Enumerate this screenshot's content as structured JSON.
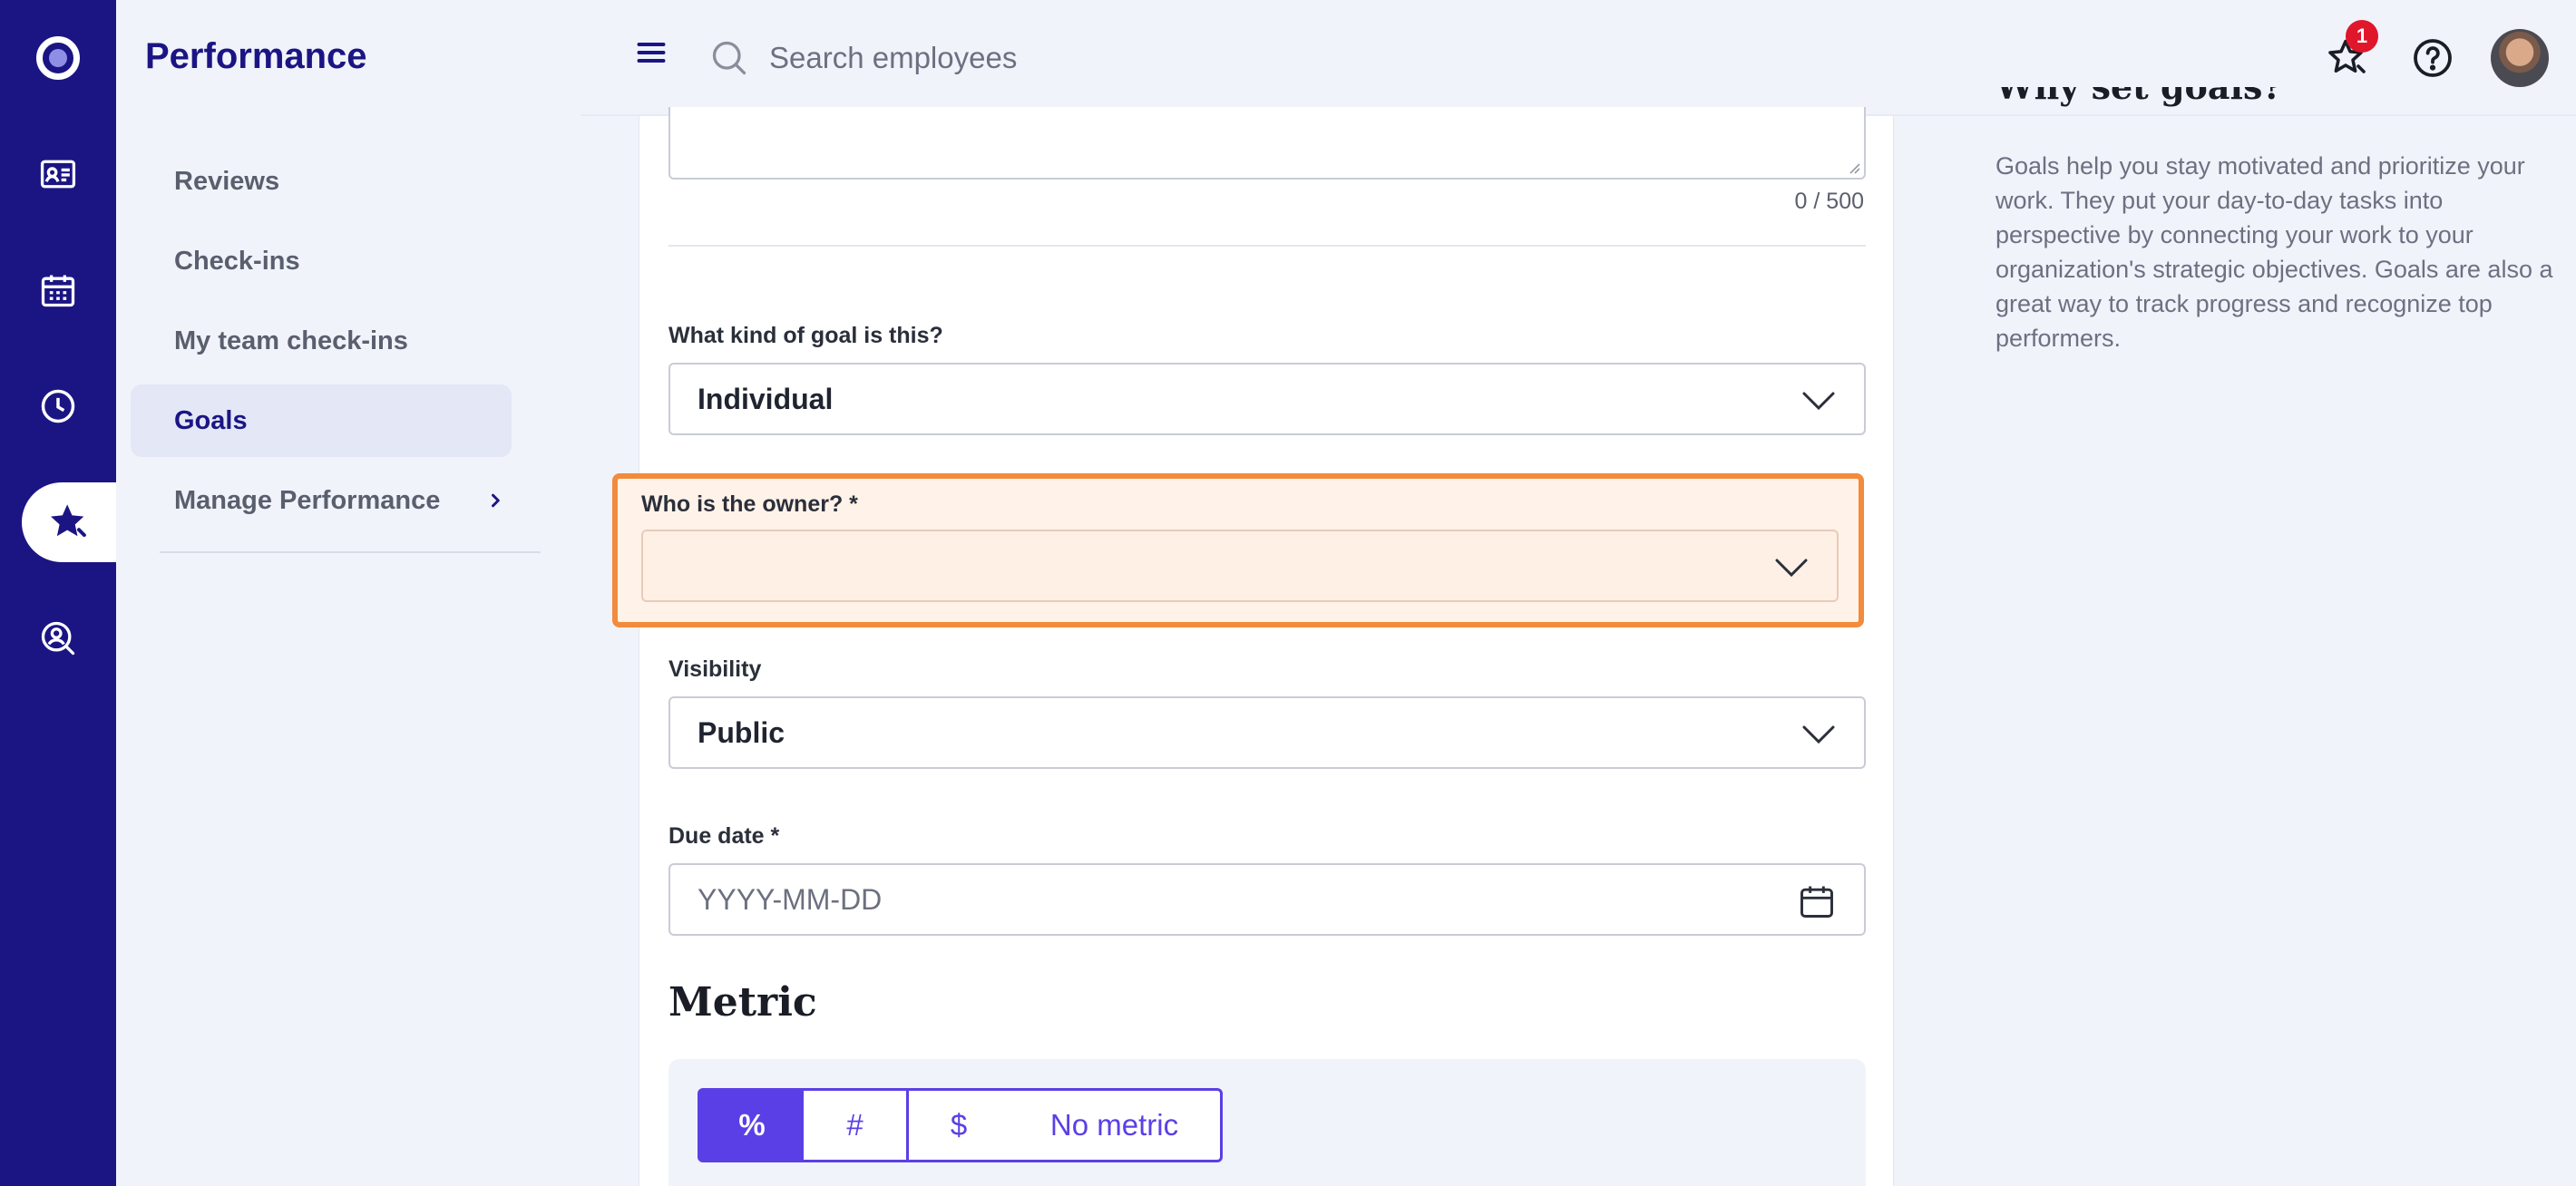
{
  "app": {
    "section_title": "Performance"
  },
  "sidebar": {
    "items": [
      {
        "label": "Reviews"
      },
      {
        "label": "Check-ins"
      },
      {
        "label": "My team check-ins"
      },
      {
        "label": "Goals",
        "active": true
      },
      {
        "label": "Manage Performance",
        "has_submenu": true
      }
    ]
  },
  "rail": {
    "icons": [
      "logo-icon",
      "id-card-icon",
      "calendar-icon",
      "clock-icon",
      "star-icon",
      "search-person-icon"
    ],
    "active_icon": "star-icon"
  },
  "topbar": {
    "search_placeholder": "Search employees",
    "notification_count": "1"
  },
  "form": {
    "char_count": "0 / 500",
    "goal_type": {
      "label": "What kind of goal is this?",
      "value": "Individual"
    },
    "owner": {
      "label": "Who is the owner? *",
      "value": ""
    },
    "visibility": {
      "label": "Visibility",
      "value": "Public"
    },
    "due_date": {
      "label": "Due date *",
      "placeholder": "YYYY-MM-DD"
    },
    "metric": {
      "title": "Metric",
      "options": [
        "%",
        "#",
        "$",
        "No metric"
      ],
      "selected": "%"
    }
  },
  "help": {
    "title": "Why set goals?",
    "text": "Goals help you stay motivated and prioritize your work. They put your day-to-day tasks into perspective by connecting your work to your organization's strategic objectives. Goals are also a great way to track progress and recognize top performers."
  },
  "colors": {
    "rail_bg": "#1b1584",
    "accent": "#5b3fe6",
    "highlight_border": "#f28b3c",
    "badge": "#e0162b"
  }
}
